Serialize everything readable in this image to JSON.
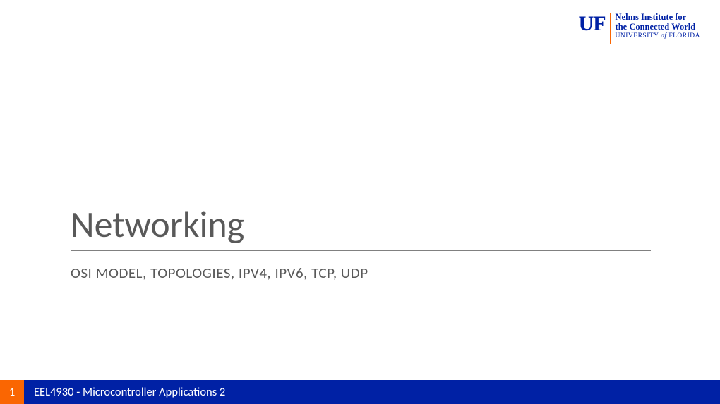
{
  "logo": {
    "mark": "UF",
    "line1": "Nelms Institute for",
    "line2": "the Connected World",
    "line3_a": "UNIVERSITY ",
    "line3_of": "of",
    "line3_b": " FLORIDA"
  },
  "slide": {
    "title": "Networking",
    "subtitle": "OSI MODEL, TOPOLOGIES, IPV4, IPV6, TCP, UDP"
  },
  "footer": {
    "page": "1",
    "course": "EEL4930 - Microcontroller Applications 2"
  }
}
